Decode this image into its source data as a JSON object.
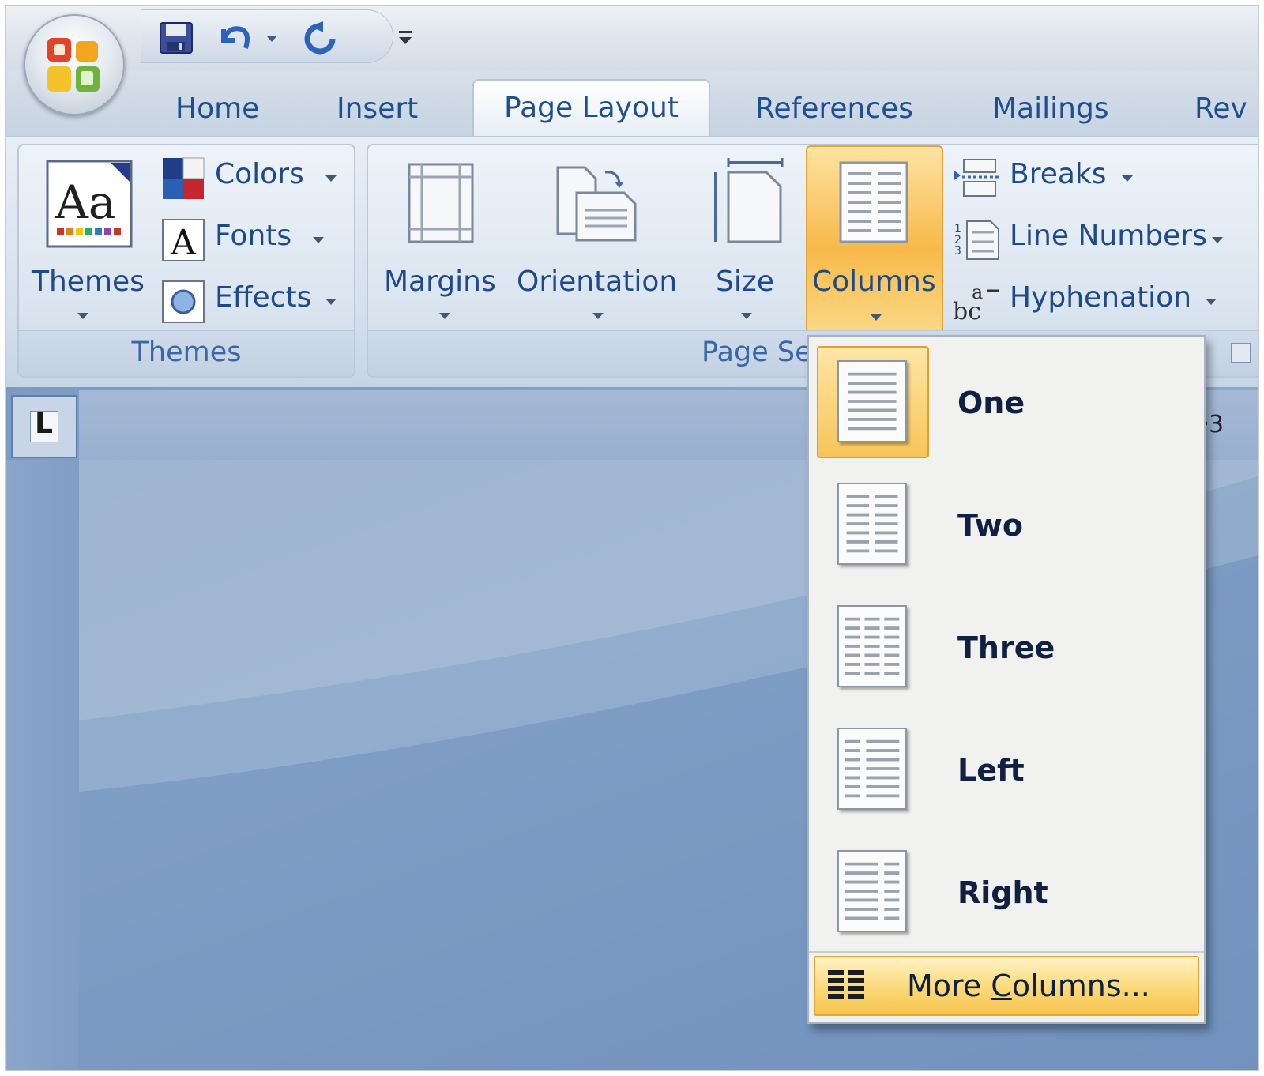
{
  "tabs": [
    {
      "label": "Home"
    },
    {
      "label": "Insert"
    },
    {
      "label": "Page Layout",
      "active": true
    },
    {
      "label": "References"
    },
    {
      "label": "Mailings"
    },
    {
      "label": "Rev"
    }
  ],
  "themes_group": {
    "title": "Themes",
    "themes_button": "Themes",
    "colors": "Colors",
    "fonts": "Fonts",
    "effects": "Effects"
  },
  "page_setup_group": {
    "title": "Page Se",
    "margins": "Margins",
    "orientation": "Orientation",
    "size": "Size",
    "columns": "Columns",
    "breaks": "Breaks",
    "line_numbers": "Line Numbers",
    "hyphenation": "Hyphenation"
  },
  "columns_menu": {
    "items": [
      {
        "label": "One",
        "selected": true
      },
      {
        "label": "Two"
      },
      {
        "label": "Three"
      },
      {
        "label": "Left"
      },
      {
        "label": "Right"
      }
    ],
    "more_prefix": "More ",
    "more_accel": "C",
    "more_suffix": "olumns..."
  },
  "ruler": {
    "tab_selector_glyph": "L",
    "visible_number": "3"
  },
  "colors": {
    "tab_text": "#1f4f8f",
    "highlight": "#f8c55a",
    "doc_bg": "#7c9bc2"
  }
}
